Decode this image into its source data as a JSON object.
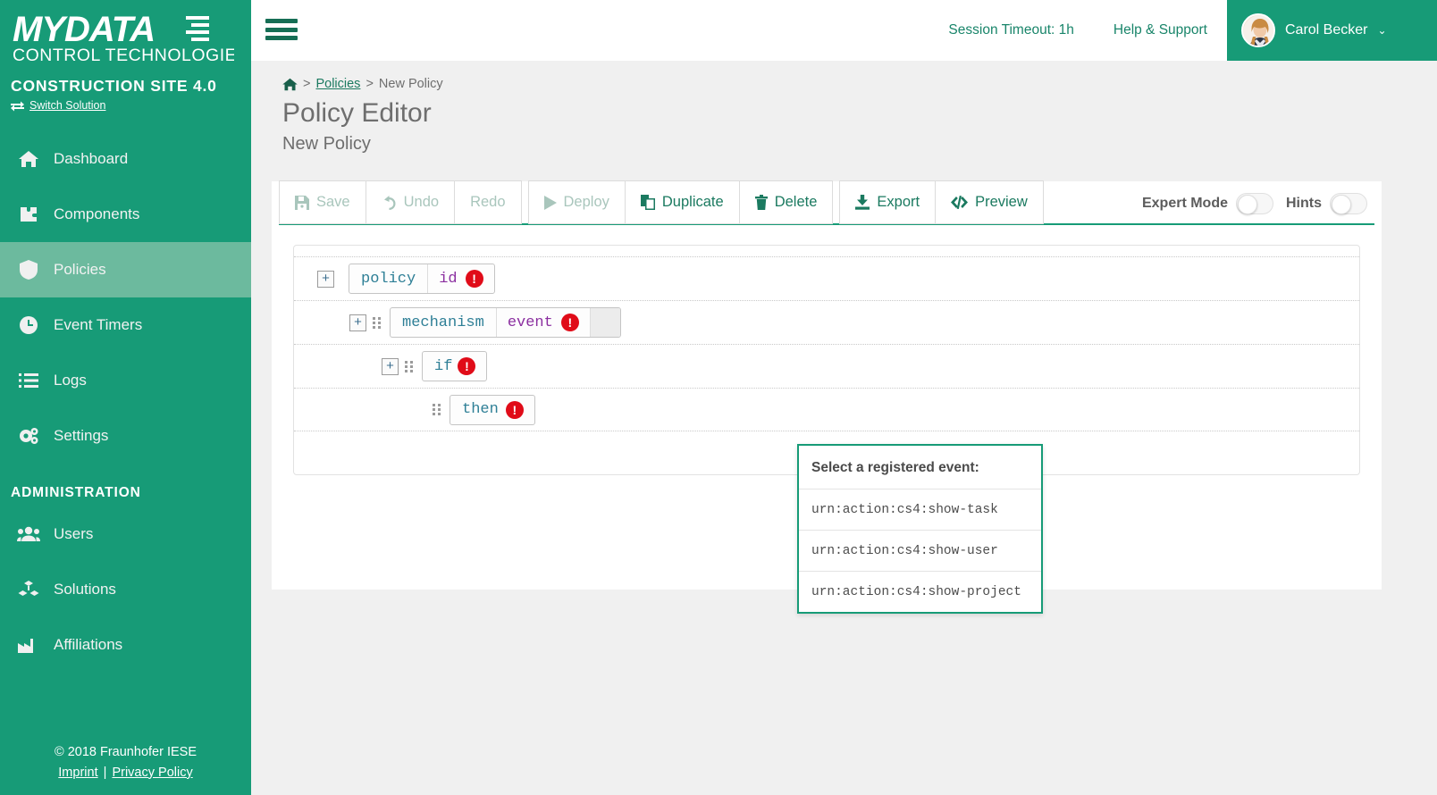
{
  "sidebar": {
    "logo": {
      "line1": "MYDATA",
      "line2": "CONTROL TECHNOLOGIES"
    },
    "solution_name": "CONSTRUCTION SITE 4.0",
    "switch_solution": "Switch Solution",
    "nav": [
      {
        "label": "Dashboard",
        "icon": "home-icon",
        "active": false
      },
      {
        "label": "Components",
        "icon": "puzzle-icon",
        "active": false
      },
      {
        "label": "Policies",
        "icon": "shield-icon",
        "active": true
      },
      {
        "label": "Event Timers",
        "icon": "clock-icon",
        "active": false
      },
      {
        "label": "Logs",
        "icon": "list-icon",
        "active": false
      },
      {
        "label": "Settings",
        "icon": "gears-icon",
        "active": false
      }
    ],
    "admin_heading": "ADMINISTRATION",
    "admin_nav": [
      {
        "label": "Users",
        "icon": "users-icon"
      },
      {
        "label": "Solutions",
        "icon": "cubes-icon"
      },
      {
        "label": "Affiliations",
        "icon": "factory-icon"
      }
    ],
    "footer": {
      "copyright": "© 2018 Fraunhofer IESE",
      "imprint": "Imprint",
      "separator": "|",
      "privacy": "Privacy Policy"
    }
  },
  "topbar": {
    "session_timeout": "Session Timeout: 1h",
    "help_support": "Help & Support",
    "user_name": "Carol Becker",
    "caret": "⌄"
  },
  "breadcrumb": {
    "home_icon": "home-icon",
    "sep1": ">",
    "policies": "Policies",
    "sep2": ">",
    "current": "New Policy"
  },
  "page": {
    "title": "Policy Editor",
    "subtitle": "New Policy"
  },
  "toolbar": {
    "groups": [
      [
        {
          "label": "Save",
          "icon": "save-icon",
          "disabled": true
        },
        {
          "label": "Undo",
          "icon": "undo-icon",
          "disabled": true
        },
        {
          "label": "Redo",
          "icon": "",
          "disabled": true
        }
      ],
      [
        {
          "label": "Deploy",
          "icon": "play-icon",
          "disabled": true
        },
        {
          "label": "Duplicate",
          "icon": "copy-icon",
          "disabled": false
        },
        {
          "label": "Delete",
          "icon": "trash-icon",
          "disabled": false
        }
      ],
      [
        {
          "label": "Export",
          "icon": "download-icon",
          "disabled": false
        },
        {
          "label": "Preview",
          "icon": "code-icon",
          "disabled": false
        }
      ]
    ],
    "toggles": [
      {
        "label": "Expert Mode",
        "on": false
      },
      {
        "label": "Hints",
        "on": false
      }
    ]
  },
  "editor": {
    "rows": [
      {
        "indent": 0,
        "expander": "+",
        "handle": false,
        "key": "policy",
        "attr": "id",
        "error": "!",
        "field": false
      },
      {
        "indent": 38,
        "expander": "+",
        "handle": true,
        "key": "mechanism",
        "attr": "event",
        "error": "!",
        "field": true
      },
      {
        "indent": 74,
        "expander": "+",
        "handle": true,
        "key": "if",
        "attr": "",
        "error": "!",
        "field": false
      },
      {
        "indent": 110,
        "expander": "",
        "handle": true,
        "key": "then",
        "attr": "",
        "error": "!",
        "field": false
      }
    ]
  },
  "dropdown": {
    "header": "Select a registered event:",
    "items": [
      "urn:action:cs4:show-task",
      "urn:action:cs4:show-user",
      "urn:action:cs4:show-project"
    ]
  }
}
